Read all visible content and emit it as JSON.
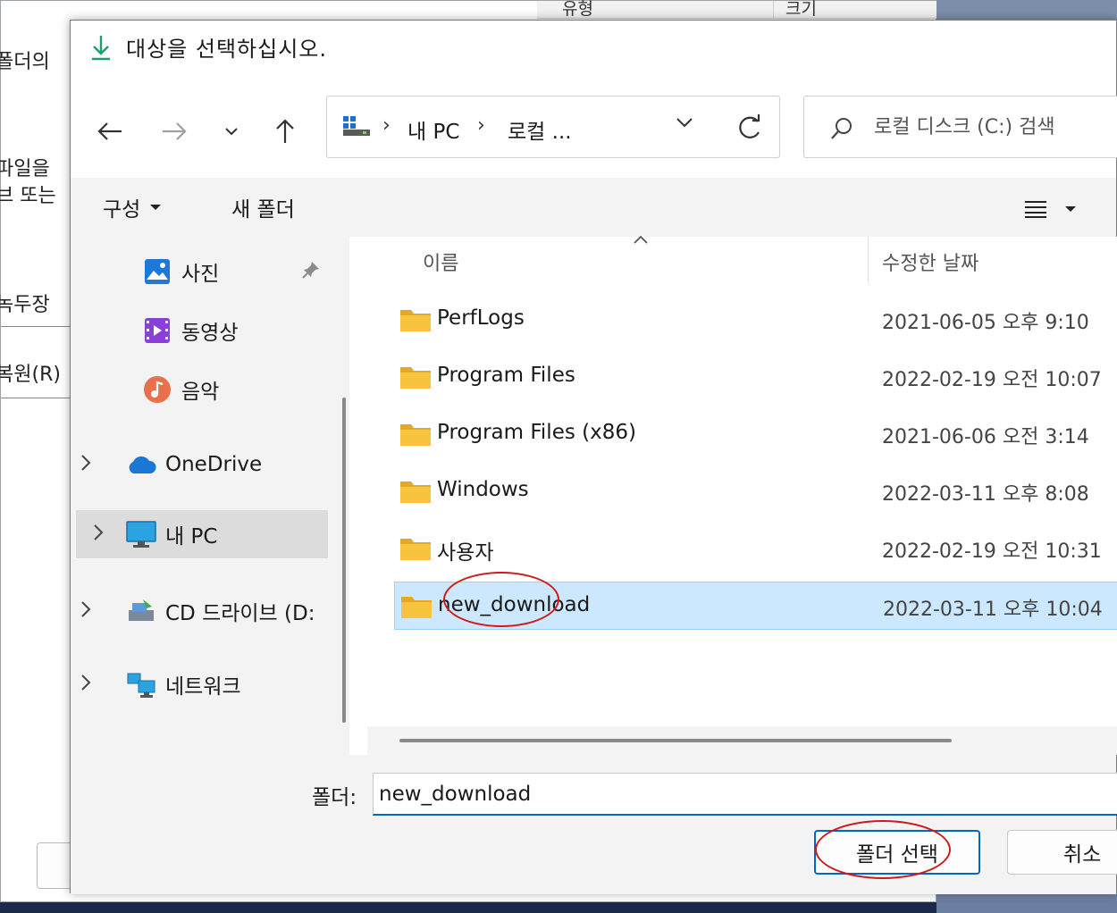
{
  "background_window": {
    "header_col1": "유형",
    "header_col2": "크기",
    "side_texts": [
      "폴더의 ",
      "파일을 ",
      "브 또는",
      "녹두장",
      "복원(R)"
    ]
  },
  "dialog": {
    "title": "대상을 선택하십시오.",
    "address": {
      "crumb_pc": "내 PC",
      "crumb_local": "로컬 ...",
      "separator": "›"
    },
    "search": {
      "placeholder": "로컬 디스크 (C:) 검색"
    },
    "toolbar": {
      "organize_label": "구성",
      "new_folder_label": "새 폴더"
    },
    "nav": {
      "items": [
        {
          "label": "사진",
          "icon": "pictures-icon"
        },
        {
          "label": "동영상",
          "icon": "videos-icon"
        },
        {
          "label": "음악",
          "icon": "music-icon"
        },
        {
          "label": "OneDrive",
          "icon": "onedrive-icon"
        },
        {
          "label": "내 PC",
          "icon": "pc-icon"
        },
        {
          "label": "CD 드라이브 (D:",
          "icon": "cd-drive-icon"
        },
        {
          "label": "네트워크",
          "icon": "network-icon"
        }
      ]
    },
    "columns": {
      "name": "이름",
      "date": "수정한 날짜"
    },
    "files": [
      {
        "name": "PerfLogs",
        "date": "2021-06-05 오후 9:10"
      },
      {
        "name": "Program Files",
        "date": "2022-02-19 오전 10:07"
      },
      {
        "name": "Program Files (x86)",
        "date": "2021-06-06 오전 3:14"
      },
      {
        "name": "Windows",
        "date": "2022-03-11 오후 8:08"
      },
      {
        "name": "사용자",
        "date": "2022-02-19 오전 10:31"
      },
      {
        "name": "new_download",
        "date": "2022-03-11 오후 10:04"
      }
    ],
    "footer": {
      "folder_label": "폴더:",
      "folder_value": "new_download",
      "select_button": "폴더 선택",
      "cancel_button": "취소"
    }
  },
  "colors": {
    "accent": "#0067c0",
    "selection": "#cce8ff",
    "annotation": "#d01a1a",
    "folder": "#f8c440"
  }
}
